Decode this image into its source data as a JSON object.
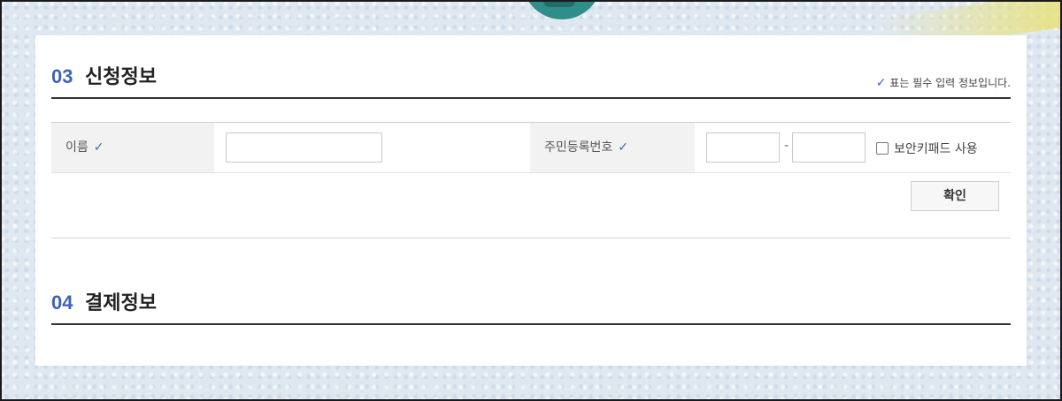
{
  "section3": {
    "number": "03",
    "title": "신청정보",
    "required_note": "표는 필수 입력 정보입니다.",
    "name_label": "이름",
    "name_value": "",
    "rrn_label": "주민등록번호",
    "rrn_front_value": "",
    "rrn_back_value": "",
    "rrn_separator": "-",
    "keypad_label": "보안키패드 사용",
    "keypad_checked": false,
    "confirm_label": "확인"
  },
  "section4": {
    "number": "04",
    "title": "결제정보"
  },
  "icons": {
    "required": "check-icon"
  },
  "colors": {
    "accent": "#3f63b4",
    "heading_rule": "#333333"
  }
}
